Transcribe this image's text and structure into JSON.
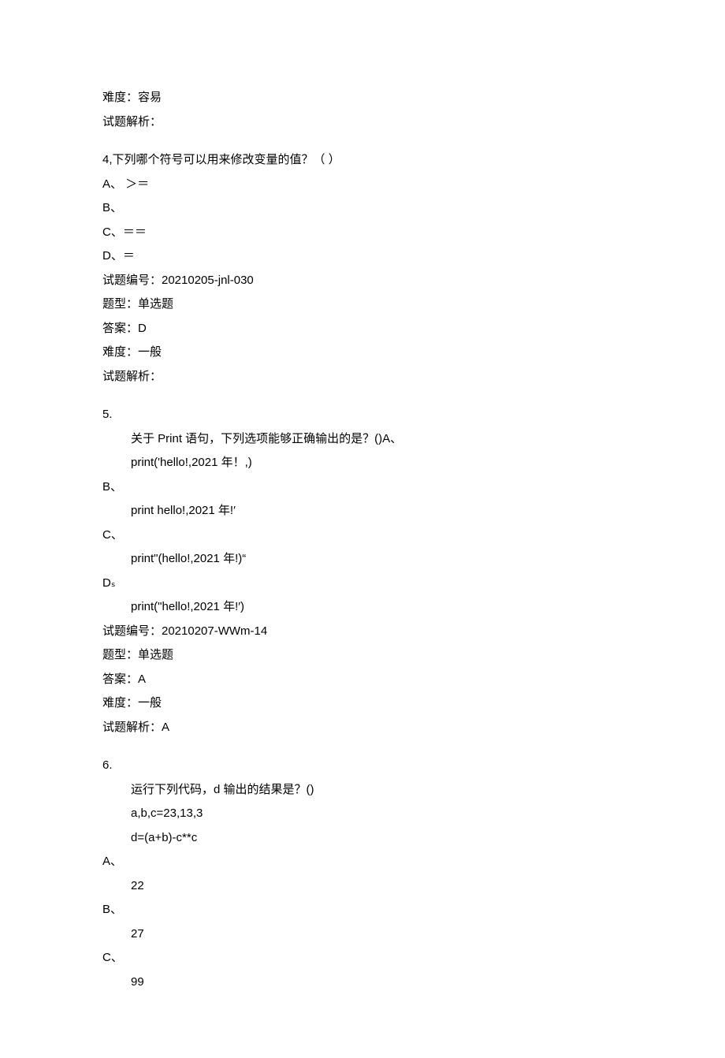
{
  "q3meta": {
    "difficulty": "难度：容易",
    "analysis": "试题解析："
  },
  "q4": {
    "prompt": "4,下列哪个符号可以用来修改变量的值？（  ）",
    "optA": "A、 ＞＝",
    "optB": "B、",
    "optC": "C、＝＝",
    "optD": "D、＝",
    "id": "试题编号：20210205-jnl-030",
    "type": "题型：单选题",
    "answer": "答案：D",
    "difficulty": "难度：一般",
    "analysis": "试题解析："
  },
  "q5": {
    "num": "5.",
    "line1": "关于 Print 语句，下列选项能够正确输出的是？()A、",
    "line2": "print('hello!,2021 年！,)",
    "optB": "B、",
    "bLine": "print hello!,2021 年!′",
    "optC": "C、",
    "cLine": "print\"(hello!,2021 年!)“",
    "optD": "Dₛ",
    "dLine": "print(\"hello!,2021 年!′)",
    "id": "试题编号：20210207-WWm-14",
    "type": "题型：单选题",
    "answer": "答案：A",
    "difficulty": "难度：一般",
    "analysis": "试题解析：A"
  },
  "q6": {
    "num": "6.",
    "line1": "运行下列代码，d 输出的结果是？()",
    "line2": "a,b,c=23,13,3",
    "line3": "d=(a+b)-c**c",
    "optA": "A、",
    "aVal": "22",
    "optB": "B、",
    "bVal": "27",
    "optC": "C、",
    "cVal": "99"
  }
}
